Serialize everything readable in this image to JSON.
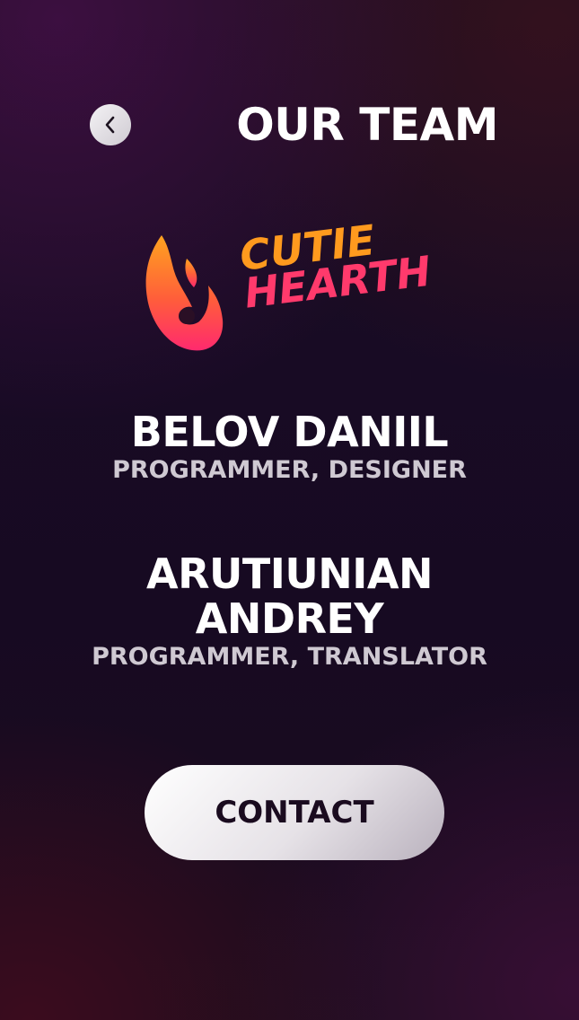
{
  "header": {
    "back_icon": "chevron-left-icon",
    "title": "OUR TEAM"
  },
  "logo": {
    "line1": "CUTIE",
    "line2": "HEARTH",
    "colors": {
      "orange": "#ff9a1e",
      "pink": "#ff3a6c"
    }
  },
  "team": [
    {
      "name": "BELOV DANIIL",
      "role": "PROGRAMMER, DESIGNER"
    },
    {
      "name": "ARUTIUNIAN\nANDREY",
      "role": "PROGRAMMER, TRANSLATOR"
    }
  ],
  "contact_label": "CONTACT"
}
